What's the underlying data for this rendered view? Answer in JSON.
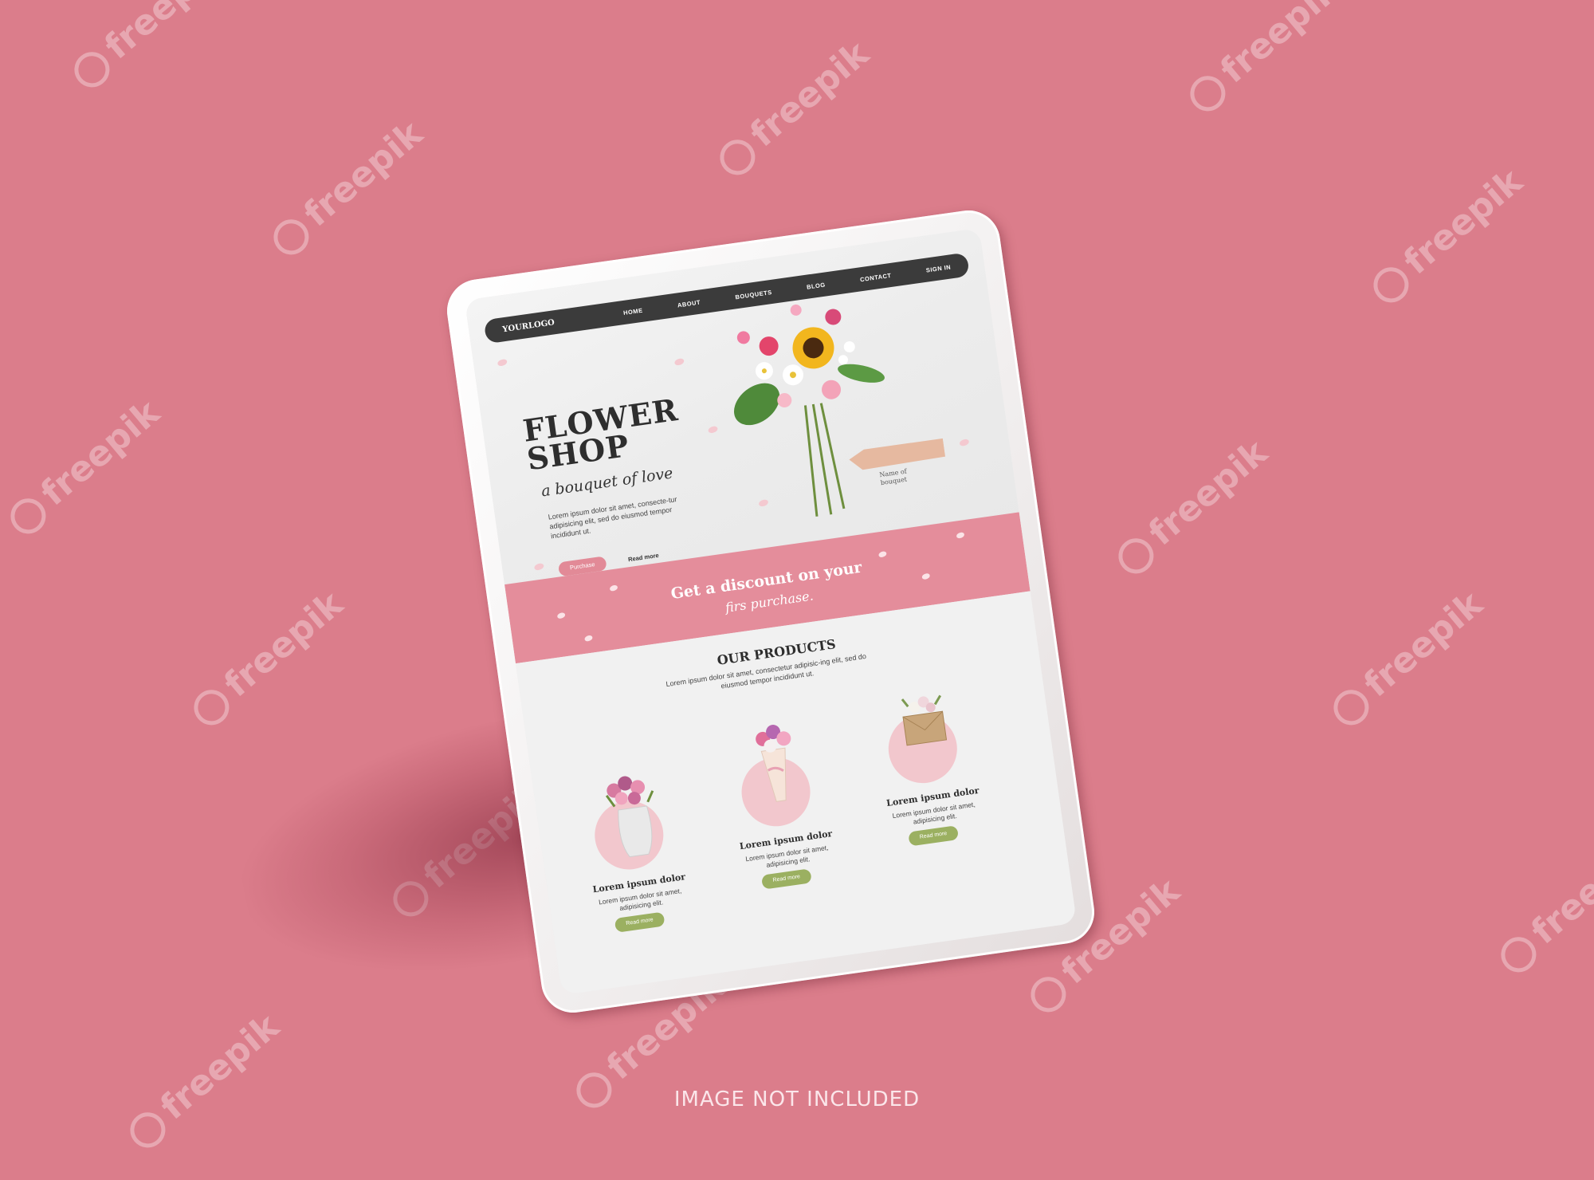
{
  "watermark": {
    "text": "freepik"
  },
  "nav": {
    "logo": "YOURLOGO",
    "items": [
      "HOME",
      "ABOUT",
      "BOUQUETS",
      "BLOG",
      "CONTACT",
      "SIGN IN"
    ]
  },
  "hero": {
    "title_line1": "FLOWER",
    "title_line2": "SHOP",
    "tagline": "a bouquet of love",
    "text": "Lorem ipsum dolor sit amet, consecte-tur adipisicing elit, sed do eiusmod tempor incididunt ut.",
    "purchase_label": "Purchase",
    "read_more_label": "Read more",
    "bouquet_label_line1": "Name of",
    "bouquet_label_line2": "bouquet"
  },
  "banner": {
    "title": "Get a discount on your",
    "subtitle": "firs purchase."
  },
  "products": {
    "title": "OUR PRODUCTS",
    "description": "Lorem ipsum dolor sit amet, consectetur adipisic-ing elit, sed do eiusmod tempor incididunt ut.",
    "items": [
      {
        "name": "Lorem ipsum dolor",
        "text": "Lorem ipsum dolor sit amet, adipisicing elit.",
        "button": "Read more"
      },
      {
        "name": "Lorem ipsum dolor",
        "text": "Lorem ipsum dolor sit amet, adipisicing elit.",
        "button": "Read more"
      },
      {
        "name": "Lorem ipsum dolor",
        "text": "Lorem ipsum dolor sit amet, adipisicing elit.",
        "button": "Read more"
      }
    ]
  },
  "caption": "IMAGE NOT INCLUDED",
  "colors": {
    "background": "#db7d8b",
    "accent_pink": "#e48d9b",
    "nav_dark": "#3b3b3b",
    "button_green": "#9bb061"
  }
}
